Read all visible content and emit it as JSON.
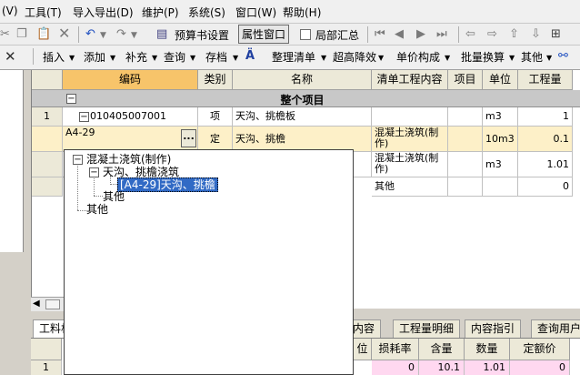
{
  "menubar": {
    "items": [
      "(V)",
      "工具(T)",
      "导入导出(D)",
      "维护(P)",
      "系统(S)",
      "窗口(W)",
      "帮助(H)"
    ]
  },
  "toolbar1": {
    "budget_settings": "预算书设置",
    "attribute_window": "属性窗口",
    "partial_summary": "局部汇总"
  },
  "toolbar2": {
    "items": [
      "插入",
      "添加",
      "补充",
      "查询",
      "存档",
      "整理清单",
      "超高降效",
      "单价构成",
      "批量换算",
      "其他"
    ]
  },
  "grid": {
    "headers": [
      "编码",
      "类别",
      "名称",
      "清单工程内容",
      "项目",
      "单位",
      "工程量"
    ],
    "group_title": "整个项目",
    "rows": [
      {
        "num": "1",
        "code": "010405007001",
        "type": "项",
        "name": "天沟、挑檐板",
        "content": "",
        "unit": "m3",
        "qty": "1"
      },
      {
        "num": "",
        "code": "A4-29",
        "type": "定",
        "name": "天沟、挑檐",
        "content": "混凝土浇筑(制作)",
        "unit": "10m3",
        "qty": "0.1"
      },
      {
        "num": "",
        "code": "",
        "type": "",
        "name": "",
        "content": "混凝土浇筑(制作)",
        "unit": "m3",
        "qty": "1.01"
      },
      {
        "num": "",
        "code": "",
        "type": "",
        "name": "",
        "content": "其他",
        "unit": "",
        "qty": "0"
      }
    ],
    "ellipsis": "..."
  },
  "popup": {
    "root": "混凝土浇筑(制作)",
    "child": "天沟、挑檐浇筑",
    "selected": "[A4-29]天沟、挑檐",
    "other_inner": "其他",
    "other_outer": "其他"
  },
  "tabs": {
    "left": "工料机",
    "items": [
      "充内容",
      "工程量明细",
      "内容指引",
      "查询用户"
    ]
  },
  "bottom_grid": {
    "headers": [
      "位",
      "损耗率",
      "含量",
      "数量",
      "定额价"
    ],
    "row_num": "1",
    "values": [
      "0",
      "10.1",
      "1.01",
      "0"
    ]
  }
}
